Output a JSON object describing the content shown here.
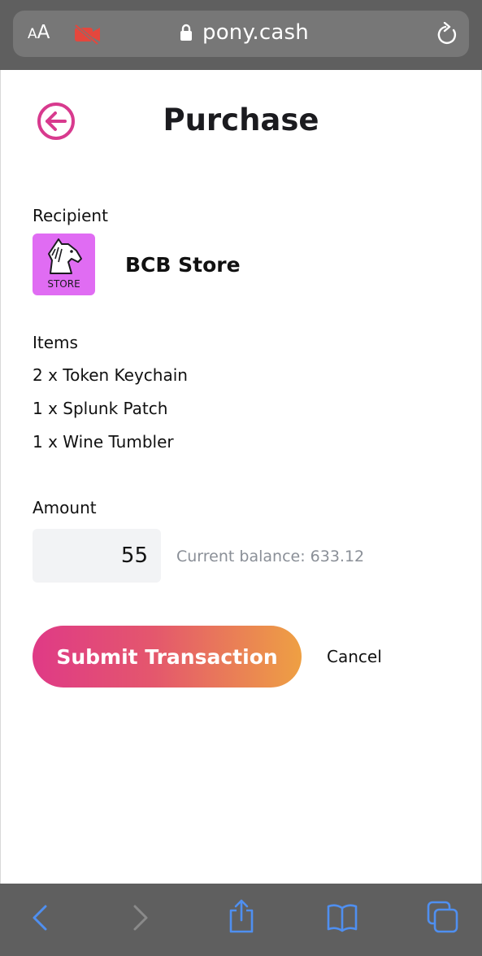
{
  "browser": {
    "text_size_small": "A",
    "text_size_large": "A",
    "url": "pony.cash"
  },
  "header": {
    "title": "Purchase"
  },
  "recipient": {
    "label": "Recipient",
    "avatar_text": "STORE",
    "name": "BCB Store"
  },
  "items": {
    "label": "Items",
    "list": [
      "2 x Token Keychain",
      "1 x Splunk Patch",
      "1 x Wine Tumbler"
    ]
  },
  "amount": {
    "label": "Amount",
    "value": "55",
    "balance_text": "Current balance: 633.12"
  },
  "actions": {
    "submit_label": "Submit Transaction",
    "cancel_label": "Cancel"
  },
  "colors": {
    "accent": "#d83a8e",
    "gradient_start": "#df3a86",
    "gradient_end": "#eea043",
    "avatar_bg": "#e06cf3",
    "toolbar_icon": "#4f8ff0"
  },
  "icons": {
    "back": "circle-arrow-left-icon",
    "camera_off": "camera-off-icon",
    "lock": "lock-icon",
    "reload": "reload-icon",
    "nav_back": "chevron-left-icon",
    "nav_forward": "chevron-right-icon",
    "share": "share-icon",
    "bookmarks": "book-icon",
    "tabs": "tabs-icon",
    "avatar": "horse-head-icon"
  }
}
